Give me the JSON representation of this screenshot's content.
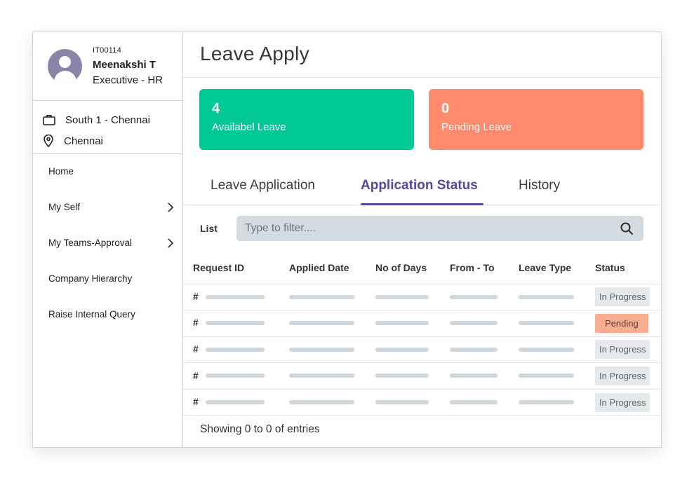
{
  "profile": {
    "emp_id": "IT00114",
    "name": "Meenakshi T",
    "role": "Executive - HR",
    "branch": "South 1 - Chennai",
    "city": "Chennai"
  },
  "nav": [
    {
      "label": "Home",
      "has_arrow": false
    },
    {
      "label": "My Self",
      "has_arrow": true
    },
    {
      "label": "My Teams-Approval",
      "has_arrow": true
    },
    {
      "label": "Company Hierarchy",
      "has_arrow": false
    },
    {
      "label": "Raise Internal Query",
      "has_arrow": false
    }
  ],
  "page": {
    "title": "Leave Apply"
  },
  "cards": [
    {
      "count": "4",
      "label": "Availabel Leave",
      "color": "#00c896"
    },
    {
      "count": "0",
      "label": "Pending Leave",
      "color": "#ff8a6c"
    }
  ],
  "tabs": [
    {
      "label": "Leave Application",
      "active": false
    },
    {
      "label": "Application Status",
      "active": true
    },
    {
      "label": "History",
      "active": false
    }
  ],
  "filter": {
    "label": "List",
    "placeholder": "Type to filter...."
  },
  "table": {
    "columns": [
      "Request ID",
      "Applied Date",
      "No of Days",
      "From - To",
      "Leave Type",
      "Status"
    ],
    "rows": [
      {
        "id": "#",
        "status": "In Progress"
      },
      {
        "id": "#",
        "status": "Pending"
      },
      {
        "id": "#",
        "status": "In Progress"
      },
      {
        "id": "#",
        "status": "In Progress"
      },
      {
        "id": "#",
        "status": "In Progress"
      }
    ]
  },
  "footer": {
    "entries_text": "Showing 0 to 0 of entries"
  },
  "colors": {
    "accent": "#534a9b",
    "available": "#00c896",
    "pending": "#ff8a6c"
  },
  "icons": {
    "avatar": "user-avatar-icon",
    "branch": "briefcase-icon",
    "city": "map-pin-icon",
    "arrow": "chevron-right-icon",
    "search": "search-icon"
  }
}
